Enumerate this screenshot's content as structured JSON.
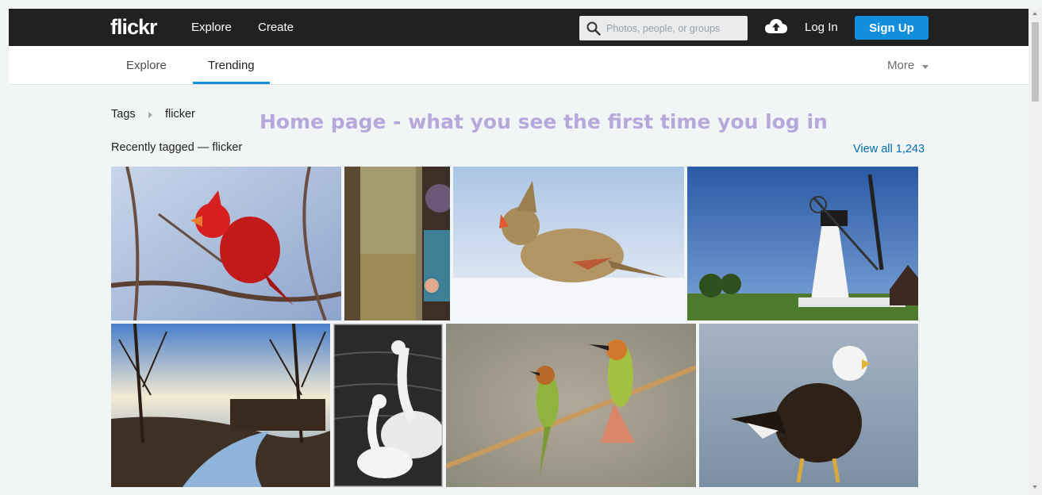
{
  "header": {
    "logo": "flickr",
    "nav": [
      "Explore",
      "Create"
    ],
    "search_placeholder": "Photos, people, or groups",
    "login": "Log In",
    "signup": "Sign Up"
  },
  "subnav": {
    "tabs": [
      "Explore",
      "Trending"
    ],
    "active_tab": "Trending",
    "more": "More"
  },
  "breadcrumb": {
    "root": "Tags",
    "current": "flicker"
  },
  "overlay_note": "Home page - what you see the first time you log in",
  "section": {
    "title": "Recently tagged — flicker",
    "view_all": "View all 1,243"
  },
  "photos": [
    {
      "subject": "red-cardinal"
    },
    {
      "subject": "painting-with-child"
    },
    {
      "subject": "female-cardinal-in-snow"
    },
    {
      "subject": "windmill"
    },
    {
      "subject": "winter-creek"
    },
    {
      "subject": "swans"
    },
    {
      "subject": "bee-eaters"
    },
    {
      "subject": "bald-eagle"
    }
  ],
  "colors": {
    "topbar": "#212124",
    "accent": "#128fdc",
    "link": "#006dac",
    "overlay": "#b6a8da",
    "background": "#f2f5f6"
  }
}
